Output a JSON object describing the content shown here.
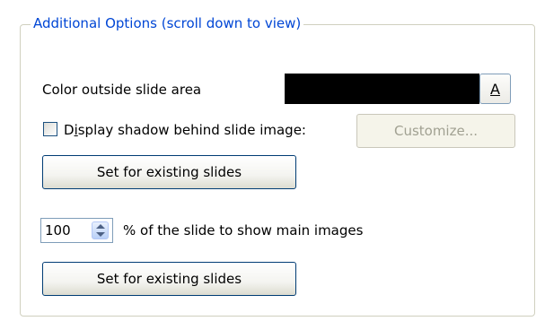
{
  "group": {
    "title": "Additional Options (scroll down to view)"
  },
  "color_row": {
    "label": "Color outside slide area",
    "swatch_color": "#000000",
    "button_label": "A"
  },
  "shadow_row": {
    "checkbox_label": "Display shadow behind slide image:",
    "checked": false,
    "customize_label": "Customize...",
    "customize_enabled": false,
    "set_existing_label": "Set for existing slides"
  },
  "main_image_row": {
    "percent_value": "100",
    "label": "% of the slide to show main images",
    "set_existing_label": "Set for existing slides"
  },
  "colors": {
    "title_blue": "#0046d5",
    "group_border": "#d0d0bf",
    "button_border": "#003c74"
  }
}
